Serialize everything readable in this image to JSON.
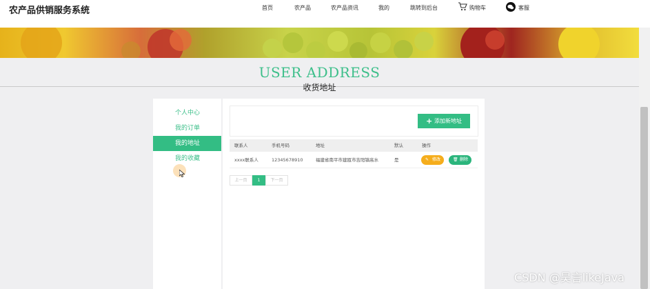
{
  "app": {
    "title": "农产品供销服务系统"
  },
  "nav": {
    "items": [
      "首页",
      "农产品",
      "农产品资讯",
      "我的",
      "跳转到后台"
    ],
    "cart_label": "购物车",
    "service_label": "客服"
  },
  "page": {
    "title_en": "USER ADDRESS",
    "title_cn": "收货地址"
  },
  "sidebar": {
    "items": [
      {
        "label": "个人中心",
        "active": false
      },
      {
        "label": "我的订单",
        "active": false
      },
      {
        "label": "我的地址",
        "active": true
      },
      {
        "label": "我的收藏",
        "active": false
      }
    ]
  },
  "toolbar": {
    "add_label": "添加新地址"
  },
  "table": {
    "headers": [
      "联系人",
      "手机号码",
      "地址",
      "默认",
      "操作"
    ],
    "rows": [
      {
        "contact": "xxxx联系人",
        "phone": "12345678910",
        "address": "福建省南平市建瓯市吉阳镇高水",
        "default": "是",
        "edit_label": "修改",
        "delete_label": "删除"
      }
    ]
  },
  "pagination": {
    "prev": "上一页",
    "current": "1",
    "next": "下一页"
  },
  "watermark": "CSDN @昊言likeJava",
  "colors": {
    "accent": "#33bd84",
    "edit": "#f5ad1c",
    "title": "#3dbf8a"
  }
}
